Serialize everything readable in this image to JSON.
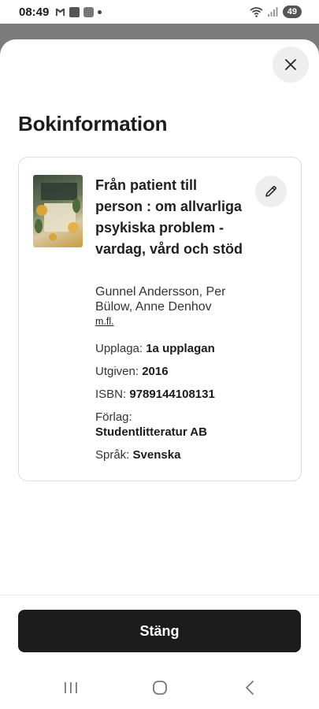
{
  "status": {
    "time": "08:49",
    "battery": "49",
    "left_icons": [
      "gmail-icon",
      "app-icon",
      "app-icon-2",
      "dot-icon"
    ],
    "right_icons": [
      "wifi-icon",
      "signal-icon",
      "battery-icon"
    ]
  },
  "sheet": {
    "title": "Bokinformation",
    "close_icon": "close-icon"
  },
  "book": {
    "title": "Från patient till person : om allvarliga psykiska problem - vardag, vård och stöd",
    "authors": "Gunnel Andersson, Per Bülow, Anne Denhov",
    "more_authors": "m.fl.",
    "edition_label": "Upplaga:",
    "edition_value": "1a upplagan",
    "published_label": "Utgiven:",
    "published_value": "2016",
    "isbn_label": "ISBN:",
    "isbn_value": "9789144108131",
    "publisher_label": "Förlag:",
    "publisher_value": "Studentlitteratur AB",
    "language_label": "Språk:",
    "language_value": "Svenska"
  },
  "footer": {
    "close_button": "Stäng"
  },
  "navbar": {
    "icons": [
      "recent-apps-icon",
      "home-icon",
      "back-icon"
    ]
  },
  "colors": {
    "primary_button": "#1c1c1c",
    "sheet_bg": "#ffffff",
    "backdrop": "#7a7a7a"
  }
}
